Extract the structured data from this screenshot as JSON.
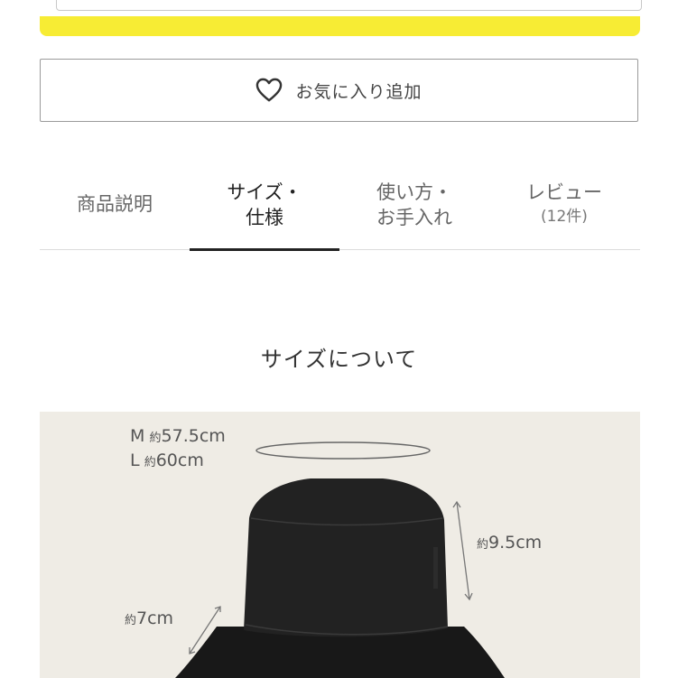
{
  "favorite": {
    "label": "お気に入り追加",
    "icon": "heart-outline-icon"
  },
  "tabs": [
    {
      "line1": "商品説明",
      "line2": "",
      "active": false
    },
    {
      "line1": "サイズ・",
      "line2": "仕様",
      "active": true
    },
    {
      "line1": "使い方・",
      "line2": "お手入れ",
      "active": false
    },
    {
      "line1": "レビュー",
      "line2": "(12件)",
      "active": false
    }
  ],
  "size_section": {
    "title": "サイズについて",
    "sizes": [
      {
        "size": "M",
        "prefix": "約",
        "value": "57.5cm"
      },
      {
        "size": "L",
        "prefix": "約",
        "value": "60cm"
      }
    ],
    "crown_height": {
      "prefix": "約",
      "value": "9.5cm"
    },
    "brim_width": {
      "prefix": "約",
      "value": "7cm"
    }
  },
  "colors": {
    "accent_yellow": "#f7ec34",
    "photo_background": "#efece5",
    "hat": "#1e1e1e",
    "active_tab_underline": "#222222"
  }
}
